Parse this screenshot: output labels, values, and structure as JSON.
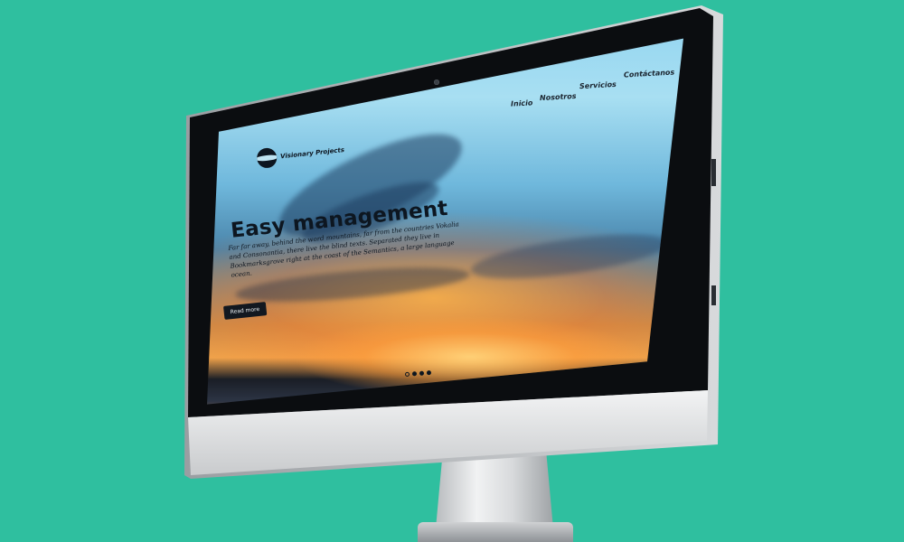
{
  "nav": {
    "items": [
      {
        "label": "Inicio"
      },
      {
        "label": "Nosotros"
      },
      {
        "label": "Servicios"
      },
      {
        "label": "Contáctanos"
      }
    ]
  },
  "logo": {
    "text": "Visionary Projects",
    "icon": "eye-logo-icon"
  },
  "hero": {
    "title": "Easy management",
    "text": "Far far away, behind the word mountains, far from the countries Vokalia and Consonantia, there live the blind texts. Separated they live in Bookmarksgrove right at the coast of the Semantics, a large language ocean.",
    "button_label": "Read more"
  },
  "slider": {
    "count": 4,
    "active_index": 0
  },
  "colors": {
    "background": "#2fbf9f",
    "bezel": "#0b0d10",
    "chin": "#e2e3e4",
    "button": "#121820"
  }
}
